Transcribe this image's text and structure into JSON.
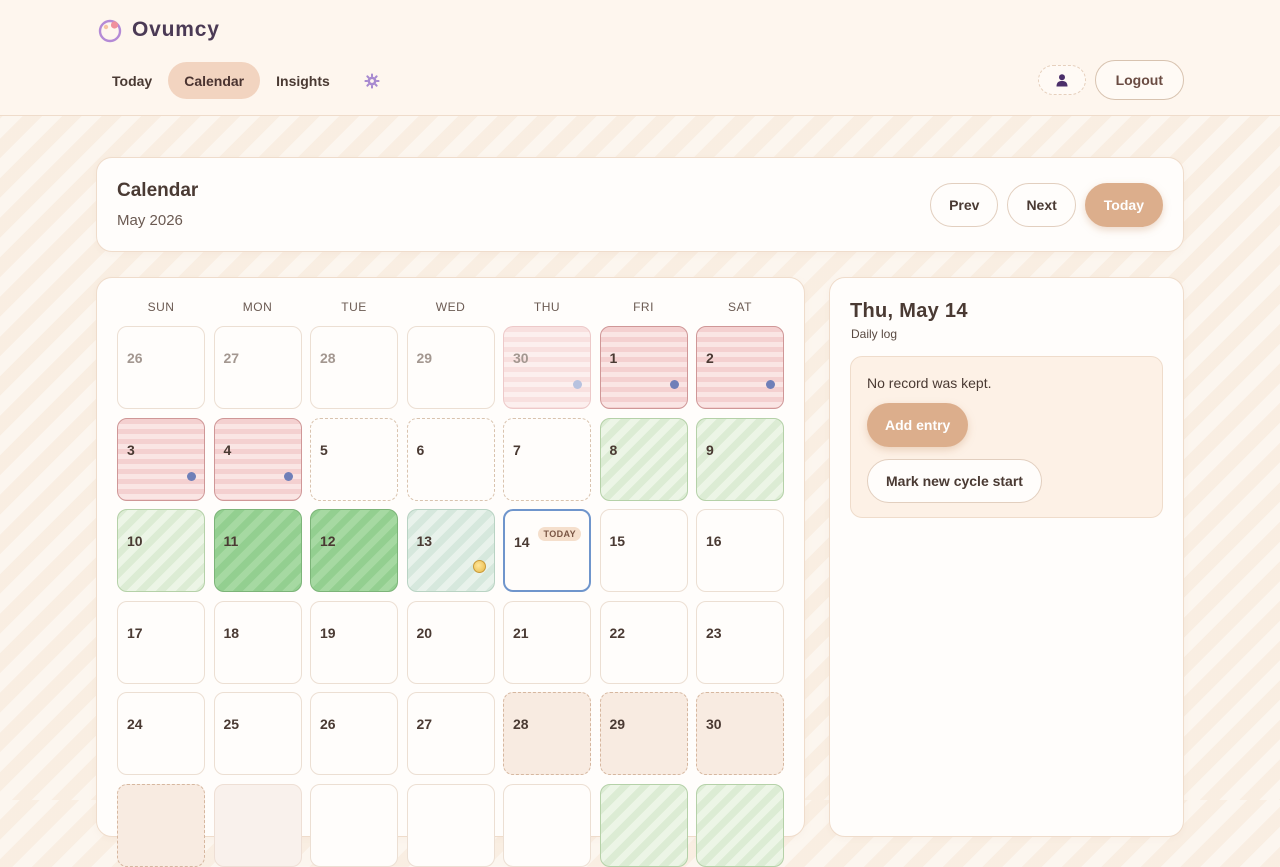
{
  "app": {
    "name": "Ovumcy"
  },
  "nav": {
    "items": [
      {
        "label": "Today",
        "active": false
      },
      {
        "label": "Calendar",
        "active": true
      },
      {
        "label": "Insights",
        "active": false
      }
    ],
    "settings_icon": "gear-icon"
  },
  "topright": {
    "profile_icon": "user-icon",
    "logout_label": "Logout"
  },
  "header": {
    "title": "Calendar",
    "month": "May 2026",
    "prev_label": "Prev",
    "next_label": "Next",
    "today_label": "Today"
  },
  "calendar": {
    "weekdays": [
      "SUN",
      "MON",
      "TUE",
      "WED",
      "THU",
      "FRI",
      "SAT"
    ],
    "today_badge": "TODAY",
    "days": [
      {
        "num": "26",
        "other": true,
        "state": "empty"
      },
      {
        "num": "27",
        "other": true,
        "state": "empty"
      },
      {
        "num": "28",
        "other": true,
        "state": "empty"
      },
      {
        "num": "29",
        "other": true,
        "state": "empty"
      },
      {
        "num": "30",
        "other": true,
        "state": "period-light",
        "marker": "dot-light"
      },
      {
        "num": "1",
        "state": "period",
        "marker": "dot"
      },
      {
        "num": "2",
        "state": "period",
        "marker": "dot"
      },
      {
        "num": "3",
        "state": "period",
        "marker": "dot"
      },
      {
        "num": "4",
        "state": "period",
        "marker": "dot"
      },
      {
        "num": "5",
        "state": "dashed"
      },
      {
        "num": "6",
        "state": "dashed"
      },
      {
        "num": "7",
        "state": "dashed"
      },
      {
        "num": "8",
        "state": "fertile"
      },
      {
        "num": "9",
        "state": "fertile"
      },
      {
        "num": "10",
        "state": "fertile"
      },
      {
        "num": "11",
        "state": "fertile-strong"
      },
      {
        "num": "12",
        "state": "fertile-strong"
      },
      {
        "num": "13",
        "state": "ovulation",
        "marker": "sun"
      },
      {
        "num": "14",
        "state": "today"
      },
      {
        "num": "15",
        "state": "empty"
      },
      {
        "num": "16",
        "state": "empty"
      },
      {
        "num": "17",
        "state": "empty"
      },
      {
        "num": "18",
        "state": "empty"
      },
      {
        "num": "19",
        "state": "empty"
      },
      {
        "num": "20",
        "state": "empty"
      },
      {
        "num": "21",
        "state": "empty"
      },
      {
        "num": "22",
        "state": "empty"
      },
      {
        "num": "23",
        "state": "empty"
      },
      {
        "num": "24",
        "state": "empty"
      },
      {
        "num": "25",
        "state": "empty"
      },
      {
        "num": "26",
        "state": "empty"
      },
      {
        "num": "27",
        "state": "empty"
      },
      {
        "num": "28",
        "state": "future-period"
      },
      {
        "num": "29",
        "state": "future-period"
      },
      {
        "num": "30",
        "state": "future-period"
      },
      {
        "num": "",
        "state": "future-period"
      },
      {
        "num": "",
        "state": "faint-period"
      },
      {
        "num": "",
        "state": "empty"
      },
      {
        "num": "",
        "state": "empty"
      },
      {
        "num": "",
        "state": "empty"
      },
      {
        "num": "",
        "state": "fertile"
      },
      {
        "num": "",
        "state": "fertile"
      }
    ]
  },
  "daily_log": {
    "title": "Thu, May 14",
    "subtitle": "Daily log",
    "empty_message": "No record was kept.",
    "add_label": "Add entry",
    "cycle_label": "Mark new cycle start"
  },
  "colors": {
    "accent": "#dcae8c",
    "period": "#f4d0d0",
    "fertile": "#dcecd4",
    "fertile_strong": "#93cf90",
    "today_border": "#6f95cc",
    "brand_text": "#4b3a55"
  }
}
